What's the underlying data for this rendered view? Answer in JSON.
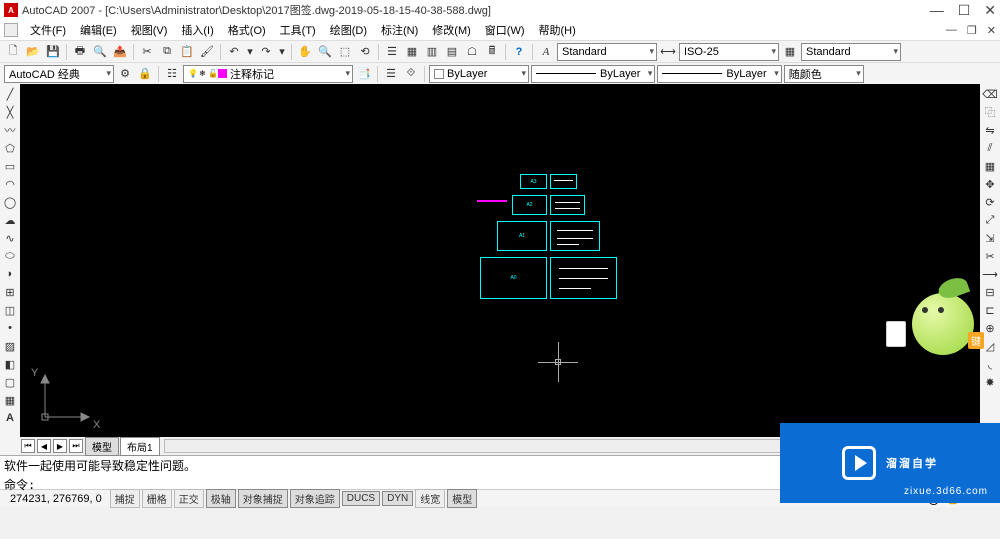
{
  "title": "AutoCAD 2007 - [C:\\Users\\Administrator\\Desktop\\2017图签.dwg-2019-05-18-15-40-38-588.dwg]",
  "menu": [
    "文件(F)",
    "编辑(E)",
    "视图(V)",
    "插入(I)",
    "格式(O)",
    "工具(T)",
    "绘图(D)",
    "标注(N)",
    "修改(M)",
    "窗口(W)",
    "帮助(H)"
  ],
  "workspace_combo": "AutoCAD 经典",
  "layer_combo": "注释标记",
  "style_combo_a": "Standard",
  "style_combo_b": "ISO-25",
  "style_combo_c": "Standard",
  "prop_color": "ByLayer",
  "prop_ltype": "ByLayer",
  "prop_lweight": "ByLayer",
  "prop_plotcolor": "随颜色",
  "tabs": {
    "model": "模型",
    "layout1": "布局1"
  },
  "cmd_hist": "软件一起使用可能导致稳定性问题。",
  "cmd_prompt": "命令:",
  "coords": "274231, 276769, 0",
  "status_btns": [
    "捕捉",
    "栅格",
    "正交",
    "极轴",
    "对象捕捉",
    "对象追踪",
    "DUCS",
    "DYN",
    "线宽",
    "模型"
  ],
  "watermark": {
    "brand": "溜溜自学",
    "url": "zixue.3d66.com"
  },
  "mascot_tag": "键",
  "ucs": {
    "x": "X",
    "y": "Y"
  },
  "boxes_left": [
    "A3",
    "A2",
    "A1",
    "A0"
  ]
}
